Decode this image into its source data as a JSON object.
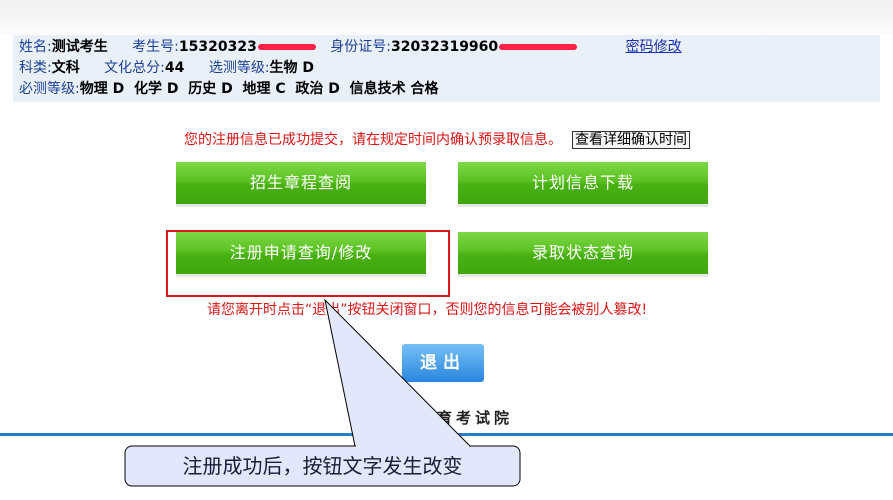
{
  "student_info": {
    "name_label": "姓名:",
    "name_value": "测试考生",
    "exam_no_label": "考生号:",
    "exam_no_value": "15320323",
    "id_label": "身份证号:",
    "id_value": "32032319960",
    "password_link": "密码修改",
    "subject_label": "科类:",
    "subject_value": "文科",
    "total_label": "文化总分:",
    "total_value": "44",
    "elective_label": "选测等级:",
    "elective_value": "生物 D",
    "required_label": "必测等级:",
    "required_value": "物理 D  化学 D  历史 D  地理 C  政治 D  信息技术 合格"
  },
  "notice": {
    "text": "您的注册信息已成功提交，请在规定时间内确认预录取信息。",
    "link": "查看详细确认时间"
  },
  "buttons": {
    "admission_rules": "招生章程查阅",
    "plan_download": "计划信息下载",
    "registration_query": "注册申请查询/修改",
    "admission_status": "录取状态查询"
  },
  "warning": "请您离开时点击“退出”按钮关闭窗口，否则您的信息可能会被别人篡改!",
  "exit_button": "退出",
  "footer_org": "教育考试院",
  "callout": {
    "text": "注册成功后，按钮文字发生改变",
    "fill_color": "#e3e7fb",
    "border_color": "#000000"
  },
  "colors": {
    "highlight_border": "#d31b1b",
    "notice_red": "#e01313",
    "green_button": "#5bc121",
    "footer_line": "#2b7cc2"
  }
}
